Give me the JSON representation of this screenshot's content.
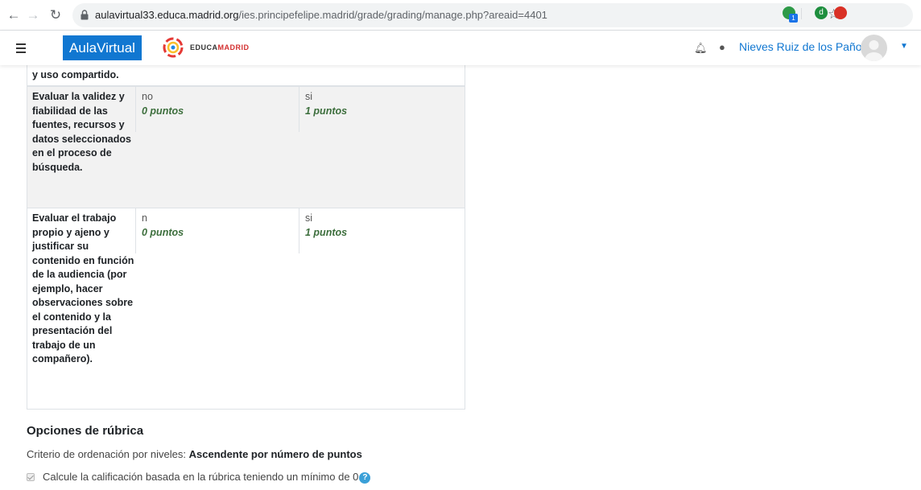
{
  "browser": {
    "url_host": "aulavirtual33.educa.madrid.org",
    "url_path": "/ies.principefelipe.madrid/grade/grading/manage.php?areaid=4401",
    "ext_badge": "1",
    "ext_letter": "d"
  },
  "navbar": {
    "brand": "AulaVirtual",
    "logo_text_1": "EDUCA",
    "logo_text_2": "MADRID",
    "user_name": "Nieves Ruiz de los Paños"
  },
  "rubric": {
    "top_fragment": "y uso compartido.",
    "criteria": [
      {
        "description": "Evaluar la validez y fiabilidad de las fuentes, recursos y datos seleccionados en el proceso de búsqueda.",
        "levels": [
          {
            "definition": "no",
            "points": "0 puntos"
          },
          {
            "definition": "si",
            "points": "1 puntos"
          }
        ]
      },
      {
        "description": "Evaluar el trabajo propio y ajeno y justificar su contenido en función de la audiencia (por ejemplo, hacer observaciones sobre el contenido y la presentación del trabajo de un compañero).",
        "levels": [
          {
            "definition": "n",
            "points": "0 puntos"
          },
          {
            "definition": "si",
            "points": "1 puntos"
          }
        ]
      }
    ]
  },
  "options": {
    "title": "Opciones de rúbrica",
    "sort_label": "Criterio de ordenación por niveles: ",
    "sort_value": "Ascendente por número de puntos",
    "min_grade_label": "Calcule la calificación basada en la rúbrica teniendo un mínimo de 0"
  }
}
